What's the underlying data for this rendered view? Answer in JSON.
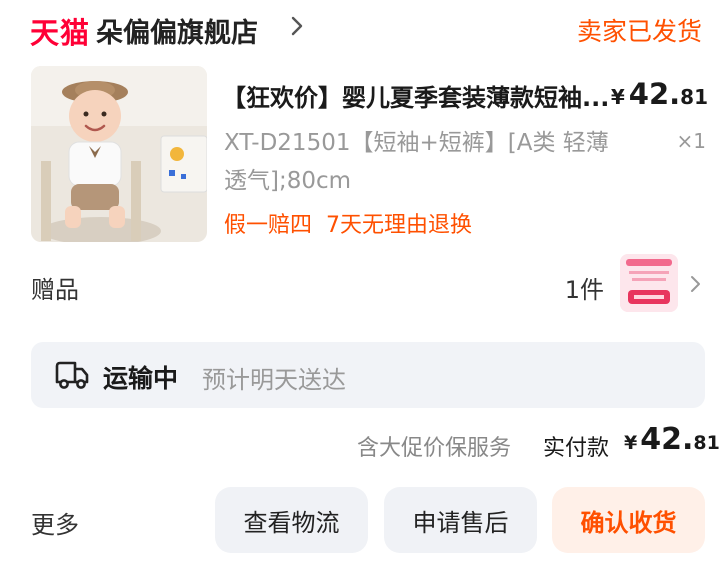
{
  "header": {
    "brand": "天猫",
    "shop_name": "朵偏偏旗舰店",
    "order_status": "卖家已发货"
  },
  "product": {
    "title": "【狂欢价】婴儿夏季套装薄款短袖...",
    "spec": "XT-D21501【短袖+短裤】[A类 轻薄透气];80cm",
    "price_symbol": "¥",
    "price_int": "42.",
    "price_dec": "81",
    "quantity": "×1",
    "guarantees": [
      "假一赔四",
      "7天无理由退换"
    ]
  },
  "gift": {
    "label": "赠品",
    "count": "1件"
  },
  "logistics": {
    "status": "运输中",
    "eta": "预计明天送达"
  },
  "totals": {
    "protection": "含大促价保服务",
    "paid_label": "实付款",
    "price_symbol": "¥",
    "price_int": "42.",
    "price_dec": "81"
  },
  "actions": {
    "more": "更多",
    "view_logistics": "查看物流",
    "after_sale": "申请售后",
    "confirm_receipt": "确认收货"
  },
  "colors": {
    "brand_red": "#ff0036",
    "accent_orange": "#ff5000",
    "muted_gray": "#999999",
    "panel_bg": "#f1f3f7"
  },
  "icons": [
    "chevron-right-icon",
    "truck-icon"
  ]
}
